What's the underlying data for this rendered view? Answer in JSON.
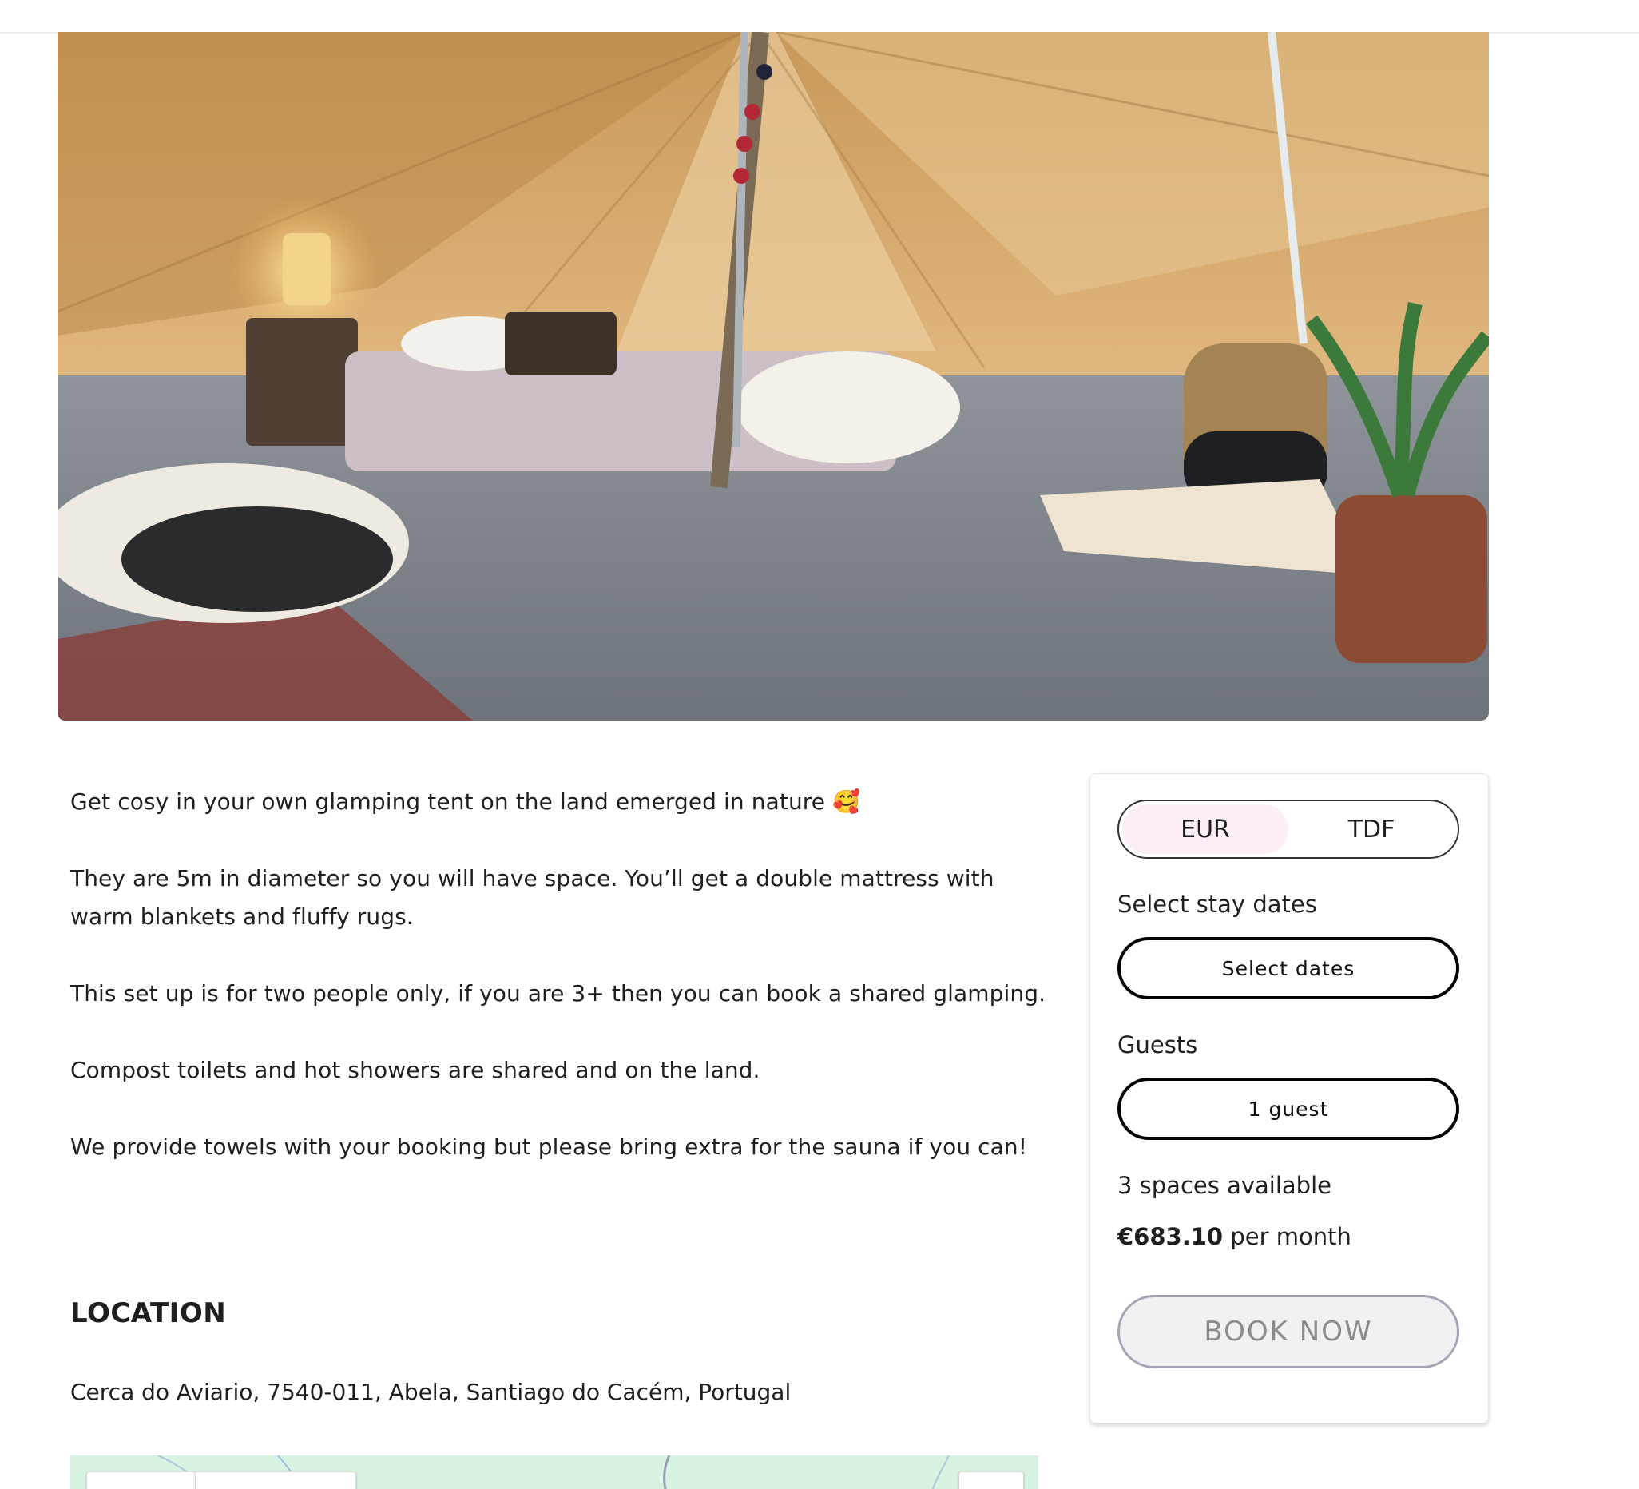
{
  "description": {
    "paragraphs": [
      "Get cosy in your own glamping tent on the land emerged in nature 🥰",
      "They are 5m in diameter so you will have space. You’ll get a double mattress with warm blankets and fluffy rugs.",
      "This set up is for two people only, if you are 3+ then you can book a shared glamping.",
      "Compost toilets and hot showers are shared and on the land.",
      "We provide towels with your booking but please bring extra for the sauna if you can!"
    ]
  },
  "location": {
    "heading": "LOCATION",
    "address": "Cerca do Aviario, 7540-011, Abela, Santiago do Cacém, Portugal"
  },
  "booking": {
    "currency_options": [
      "EUR",
      "TDF"
    ],
    "selected_currency": "EUR",
    "dates_label": "Select stay dates",
    "dates_button": "Select dates",
    "guests_label": "Guests",
    "guests_button": "1 guest",
    "spaces_available": "3 spaces available",
    "price_amount": "€683.10",
    "price_period": "per month",
    "book_button": "BOOK NOW"
  },
  "colors": {
    "active_currency_bg": "#fbeef7",
    "book_button_bg": "#f3f0f3",
    "map_bg": "#d9f3e3"
  }
}
